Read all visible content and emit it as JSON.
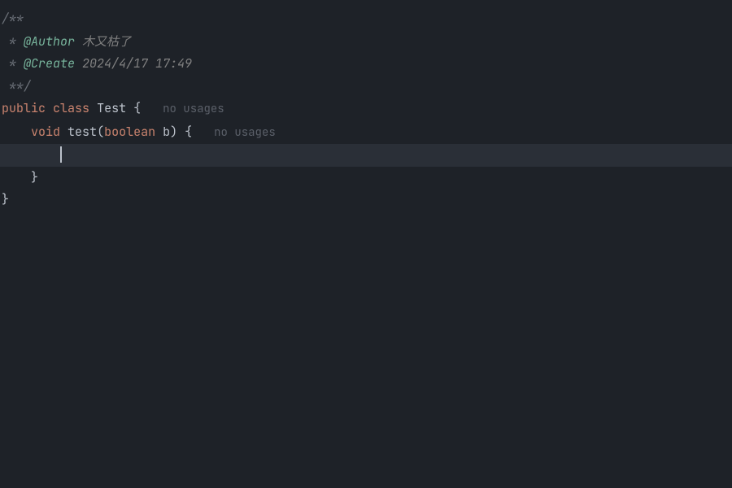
{
  "doc": {
    "open": "/**",
    "authorPrefix": " * ",
    "authorTag": "@Author",
    "authorValue": " 木又枯了",
    "createPrefix": " * ",
    "createTag": "@Create",
    "createValue": " 2024/4/17 17:49",
    "close": " **/"
  },
  "code": {
    "publicKw": "public",
    "classKw": "class",
    "className": "Test",
    "openBrace": " {",
    "usageHint1": "no usages",
    "voidKw": "void",
    "methodName": "test",
    "lparen": "(",
    "booleanKw": "boolean",
    "paramName": " b",
    "rparen": ")",
    "openBrace2": " {",
    "usageHint2": "no usages",
    "closeBrace2": "}",
    "closeBrace1": "}"
  }
}
